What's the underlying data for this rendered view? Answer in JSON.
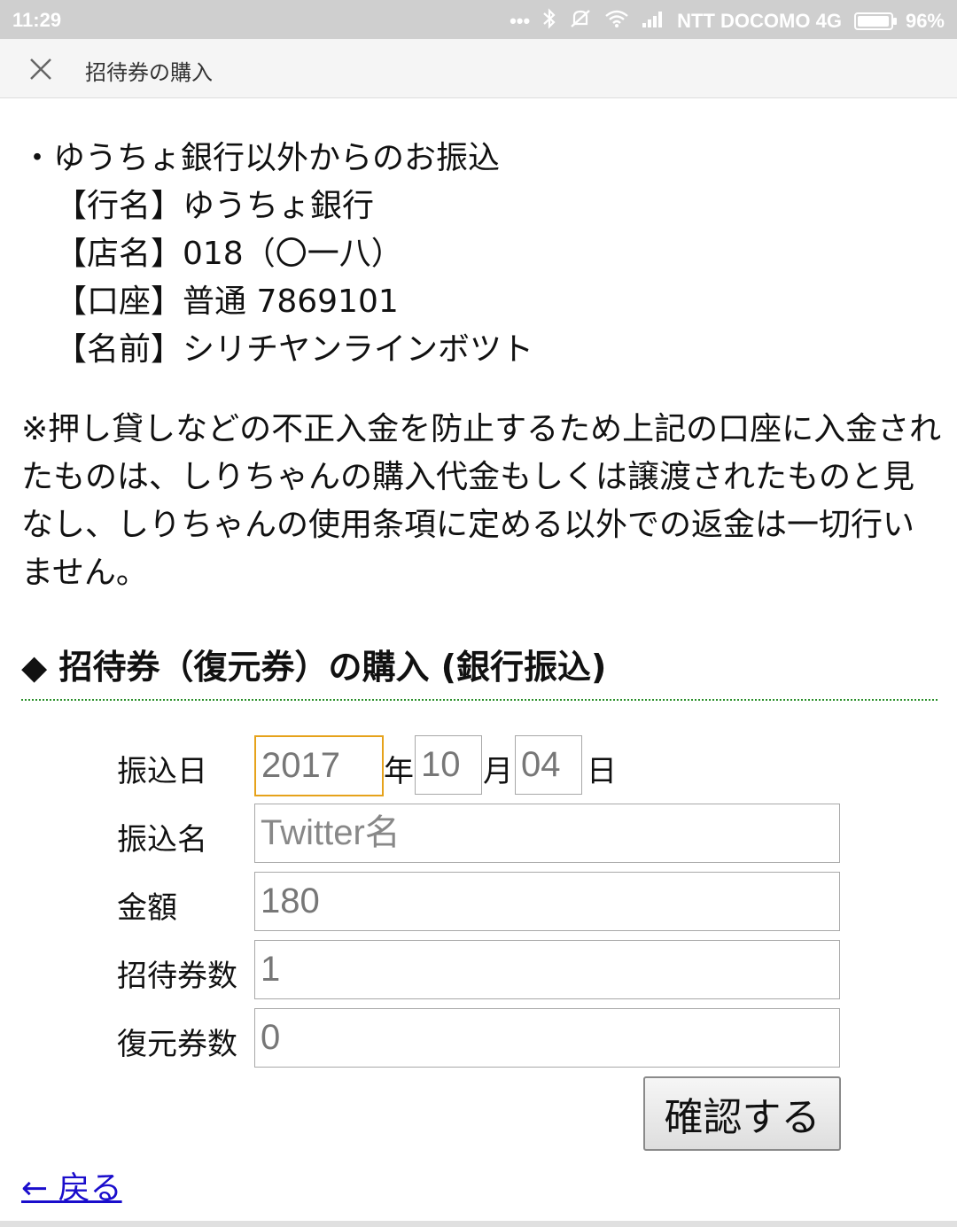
{
  "status_bar": {
    "time": "11:29",
    "carrier": "NTT DOCOMO 4G",
    "battery": "96%",
    "battery_level": 0.96,
    "icons": [
      "more-dots-icon",
      "bluetooth-icon",
      "mute-icon",
      "wifi-icon",
      "signal-icon",
      "battery-icon"
    ]
  },
  "header": {
    "title": "招待券の購入",
    "close_icon": "close-icon"
  },
  "bank_info": {
    "heading": "・ゆうちょ銀行以外からのお振込",
    "lines": [
      "【行名】ゆうちょ銀行",
      "【店名】018（〇一八）",
      "【口座】普通 7869101",
      "【名前】シリチヤンラインボツト"
    ]
  },
  "notice": "※押し貸しなどの不正入金を防止するため上記の口座に入金されたものは、しりちゃんの購入代金もしくは譲渡されたものと見なし、しりちゃんの使用条項に定める以外での返金は一切行いません。",
  "section_title": "◆ 招待券（復元券）の購入 (銀行振込)",
  "form": {
    "date_label": "振込日",
    "year_value": "2017",
    "year_unit": "年",
    "month_value": "10",
    "month_unit": "月",
    "day_value": "04",
    "day_unit": "日",
    "name_label": "振込名",
    "name_placeholder": "Twitter名",
    "amount_label": "金額",
    "amount_value": "180",
    "invite_label": "招待券数",
    "invite_value": "1",
    "restore_label": "復元券数",
    "restore_value": "0",
    "confirm_button": "確認する"
  },
  "back_link": "← 戻る",
  "colors": {
    "status_bar": "#cfcfcf",
    "focus_border": "#e6a21b",
    "divider": "#2a8f2a",
    "link": "#1a0dcc"
  }
}
